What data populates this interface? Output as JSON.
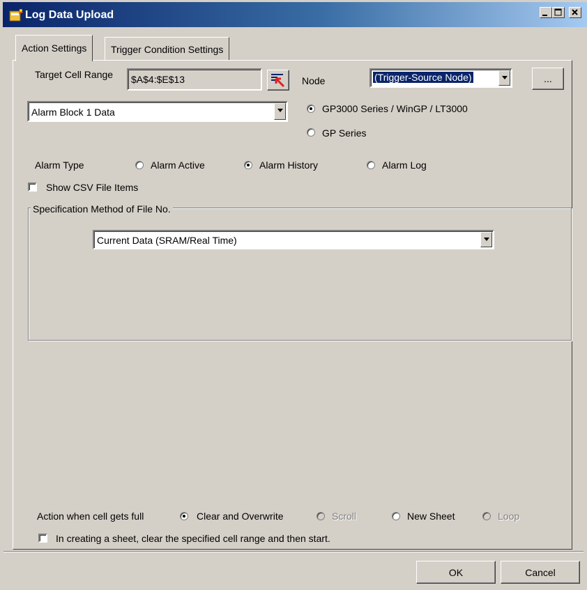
{
  "window": {
    "title": "Log Data Upload",
    "controls": [
      "minimize-icon",
      "maximize-icon",
      "close-icon"
    ]
  },
  "tabs": [
    {
      "label": "Action Settings",
      "active": true
    },
    {
      "label": "Trigger Condition Settings",
      "active": false
    }
  ],
  "target_cell": {
    "label": "Target Cell Range",
    "value": "$A$4:$E$13",
    "picker_icon": "cell-range-picker-icon"
  },
  "node": {
    "label": "Node",
    "value": "(Trigger-Source Node)",
    "browse_label": "..."
  },
  "data_type": {
    "value": "Alarm Block 1 Data"
  },
  "series": {
    "options": [
      "GP3000 Series / WinGP / LT3000",
      "GP Series"
    ],
    "selected": "GP3000 Series / WinGP / LT3000"
  },
  "alarm_type": {
    "label": "Alarm Type",
    "options": [
      "Alarm Active",
      "Alarm History",
      "Alarm Log"
    ],
    "selected": "Alarm History"
  },
  "show_csv": {
    "label": "Show CSV File Items",
    "checked": false
  },
  "file_no": {
    "group_title": "Specification Method of File No.",
    "value": "Current Data (SRAM/Real Time)"
  },
  "action_full": {
    "label": "Action when cell gets full",
    "options": [
      "Clear and Overwrite",
      "Scroll",
      "New Sheet",
      "Loop"
    ],
    "selected": "Clear and Overwrite",
    "disabled": [
      "Scroll",
      "Loop"
    ]
  },
  "clear_range": {
    "label": "In creating a sheet, clear the specified cell range and then start.",
    "checked": false
  },
  "footer": {
    "ok_label": "OK",
    "cancel_label": "Cancel"
  },
  "colors": {
    "face": "#d4d0c8",
    "title_start": "#0a246a",
    "title_end": "#a6caf0",
    "selection": "#0a246a"
  }
}
